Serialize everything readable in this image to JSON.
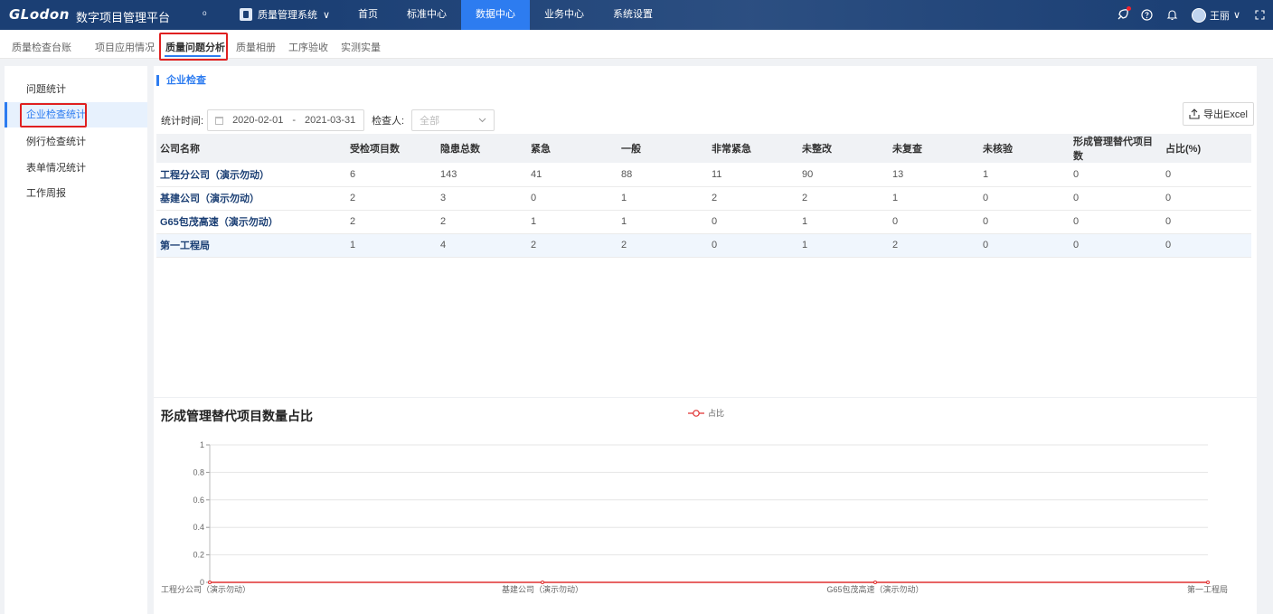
{
  "app": {
    "logo": "GLodon",
    "platform": "数字项目管理平台",
    "org_icon": "ᵒ",
    "system_select": "质量管理系统",
    "system_chevron": "∨"
  },
  "nav": [
    {
      "label": "首页",
      "active": false
    },
    {
      "label": "标准中心",
      "active": false
    },
    {
      "label": "数据中心",
      "active": true
    },
    {
      "label": "业务中心",
      "active": false
    },
    {
      "label": "系统设置",
      "active": false
    }
  ],
  "top_right": {
    "user_name": "王丽",
    "user_chevron": "∨",
    "icons": [
      "rocket-icon",
      "help-icon",
      "bell-icon",
      "fullscreen-icon"
    ]
  },
  "subnav": [
    {
      "label": "质量检查台账"
    },
    {
      "label": "项目应用情况"
    },
    {
      "label": "质量问题分析"
    },
    {
      "label": "质量相册"
    },
    {
      "label": "工序验收"
    },
    {
      "label": "实测实量"
    }
  ],
  "sidebar": [
    {
      "label": "问题统计"
    },
    {
      "label": "企业检查统计"
    },
    {
      "label": "例行检查统计"
    },
    {
      "label": "表单情况统计"
    },
    {
      "label": "工作周报"
    }
  ],
  "section_title": "企业检查",
  "filters": {
    "time_label": "统计时间:",
    "date_start": "2020-02-01",
    "date_sep": "-",
    "date_end": "2021-03-31",
    "inspector_label": "检查人:",
    "inspector_placeholder": "全部"
  },
  "export_label": "导出Excel",
  "table": {
    "headers": [
      "公司名称",
      "受检项目数",
      "隐患总数",
      "紧急",
      "一般",
      "非常紧急",
      "未整改",
      "未复查",
      "未核验",
      "形成管理替代项目数",
      "占比(%)"
    ],
    "rows": [
      [
        "工程分公司（演示勿动）",
        "6",
        "143",
        "41",
        "88",
        "11",
        "90",
        "13",
        "1",
        "0",
        "0"
      ],
      [
        "基建公司（演示勿动）",
        "2",
        "3",
        "0",
        "1",
        "2",
        "2",
        "1",
        "0",
        "0",
        "0"
      ],
      [
        "G65包茂高速（演示勿动）",
        "2",
        "2",
        "1",
        "1",
        "0",
        "1",
        "0",
        "0",
        "0",
        "0"
      ],
      [
        "第一工程局",
        "1",
        "4",
        "2",
        "2",
        "0",
        "1",
        "2",
        "0",
        "0",
        "0"
      ]
    ]
  },
  "chart_data": {
    "type": "line",
    "title": "形成管理替代项目数量占比",
    "categories": [
      "工程分公司（演示勿动）",
      "基建公司（演示勿动）",
      "G65包茂高速（演示勿动）",
      "第一工程局"
    ],
    "series": [
      {
        "name": "占比",
        "values": [
          0,
          0,
          0,
          0
        ],
        "color": "#e03030"
      }
    ],
    "ylim": [
      0,
      1
    ],
    "yticks": [
      "0",
      "0.2",
      "0.4",
      "0.6",
      "0.8",
      "1"
    ],
    "grid": true,
    "legend": "top-center"
  },
  "colors": {
    "topbar": "#1b3f74",
    "accent": "#2d7cf0",
    "highlight_box": "#e02020"
  }
}
